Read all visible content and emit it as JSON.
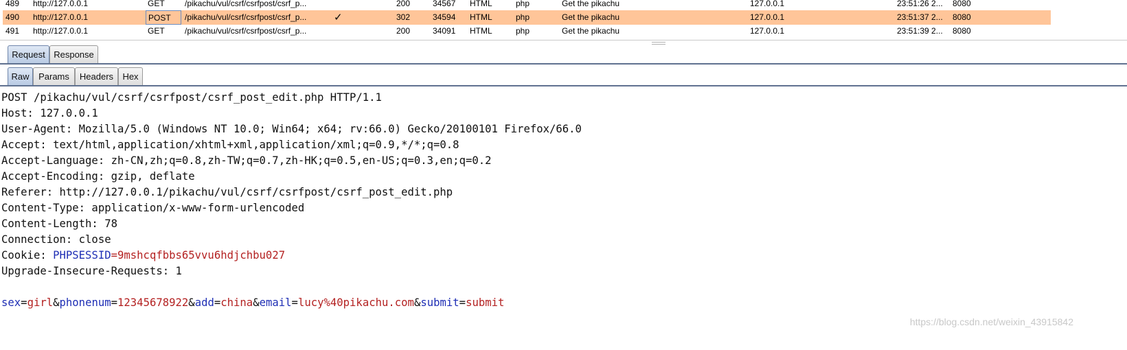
{
  "history": {
    "rows": [
      {
        "num": "489",
        "host": "http://127.0.0.1",
        "method": "GET",
        "url": "/pikachu/vul/csrf/csrfpost/csrf_p...",
        "check": "",
        "status": "200",
        "length": "34567",
        "mime": "HTML",
        "ext": "php",
        "title": "Get the pikachu",
        "ip": "127.0.0.1",
        "time": "23:51:26 2...",
        "port": "8080"
      },
      {
        "num": "490",
        "host": "http://127.0.0.1",
        "method": "POST",
        "url": "/pikachu/vul/csrf/csrfpost/csrf_p...",
        "check": "✓",
        "status": "302",
        "length": "34594",
        "mime": "HTML",
        "ext": "php",
        "title": "Get the pikachu",
        "ip": "127.0.0.1",
        "time": "23:51:37 2...",
        "port": "8080"
      },
      {
        "num": "491",
        "host": "http://127.0.0.1",
        "method": "GET",
        "url": "/pikachu/vul/csrf/csrfpost/csrf_p...",
        "check": "",
        "status": "200",
        "length": "34091",
        "mime": "HTML",
        "ext": "php",
        "title": "Get the pikachu",
        "ip": "127.0.0.1",
        "time": "23:51:39 2...",
        "port": "8080"
      }
    ]
  },
  "tabs_main": [
    "Request",
    "Response"
  ],
  "tabs_sub": [
    "Raw",
    "Params",
    "Headers",
    "Hex"
  ],
  "request": {
    "request_line": "POST /pikachu/vul/csrf/csrfpost/csrf_post_edit.php HTTP/1.1",
    "host": "Host: 127.0.0.1",
    "user_agent": "User-Agent: Mozilla/5.0 (Windows NT 10.0; Win64; x64; rv:66.0) Gecko/20100101 Firefox/66.0",
    "accept": "Accept: text/html,application/xhtml+xml,application/xml;q=0.9,*/*;q=0.8",
    "accept_language": "Accept-Language: zh-CN,zh;q=0.8,zh-TW;q=0.7,zh-HK;q=0.5,en-US;q=0.3,en;q=0.2",
    "accept_encoding": "Accept-Encoding: gzip, deflate",
    "referer": "Referer: http://127.0.0.1/pikachu/vul/csrf/csrfpost/csrf_post_edit.php",
    "content_type": "Content-Type: application/x-www-form-urlencoded",
    "content_length": "Content-Length: 78",
    "connection": "Connection: close",
    "cookie_prefix": "Cookie: ",
    "cookie_name": "PHPSESSID",
    "cookie_value": "9mshcqfbbs65vvu6hdjchbu027",
    "upgrade": "Upgrade-Insecure-Requests: 1",
    "body": [
      {
        "key": "sex",
        "value": "girl"
      },
      {
        "key": "phonenum",
        "value": "12345678922"
      },
      {
        "key": "add",
        "value": "china"
      },
      {
        "key": "email",
        "value": "lucy%40pikachu.com"
      },
      {
        "key": "submit",
        "value": "submit"
      }
    ]
  },
  "watermark": "https://blog.csdn.net/weixin_43915842",
  "colors": {
    "selected_row": "#ffc599",
    "param_key": "#1f2fb5",
    "param_value": "#b42222",
    "tab_active": "#b9cbe4"
  }
}
